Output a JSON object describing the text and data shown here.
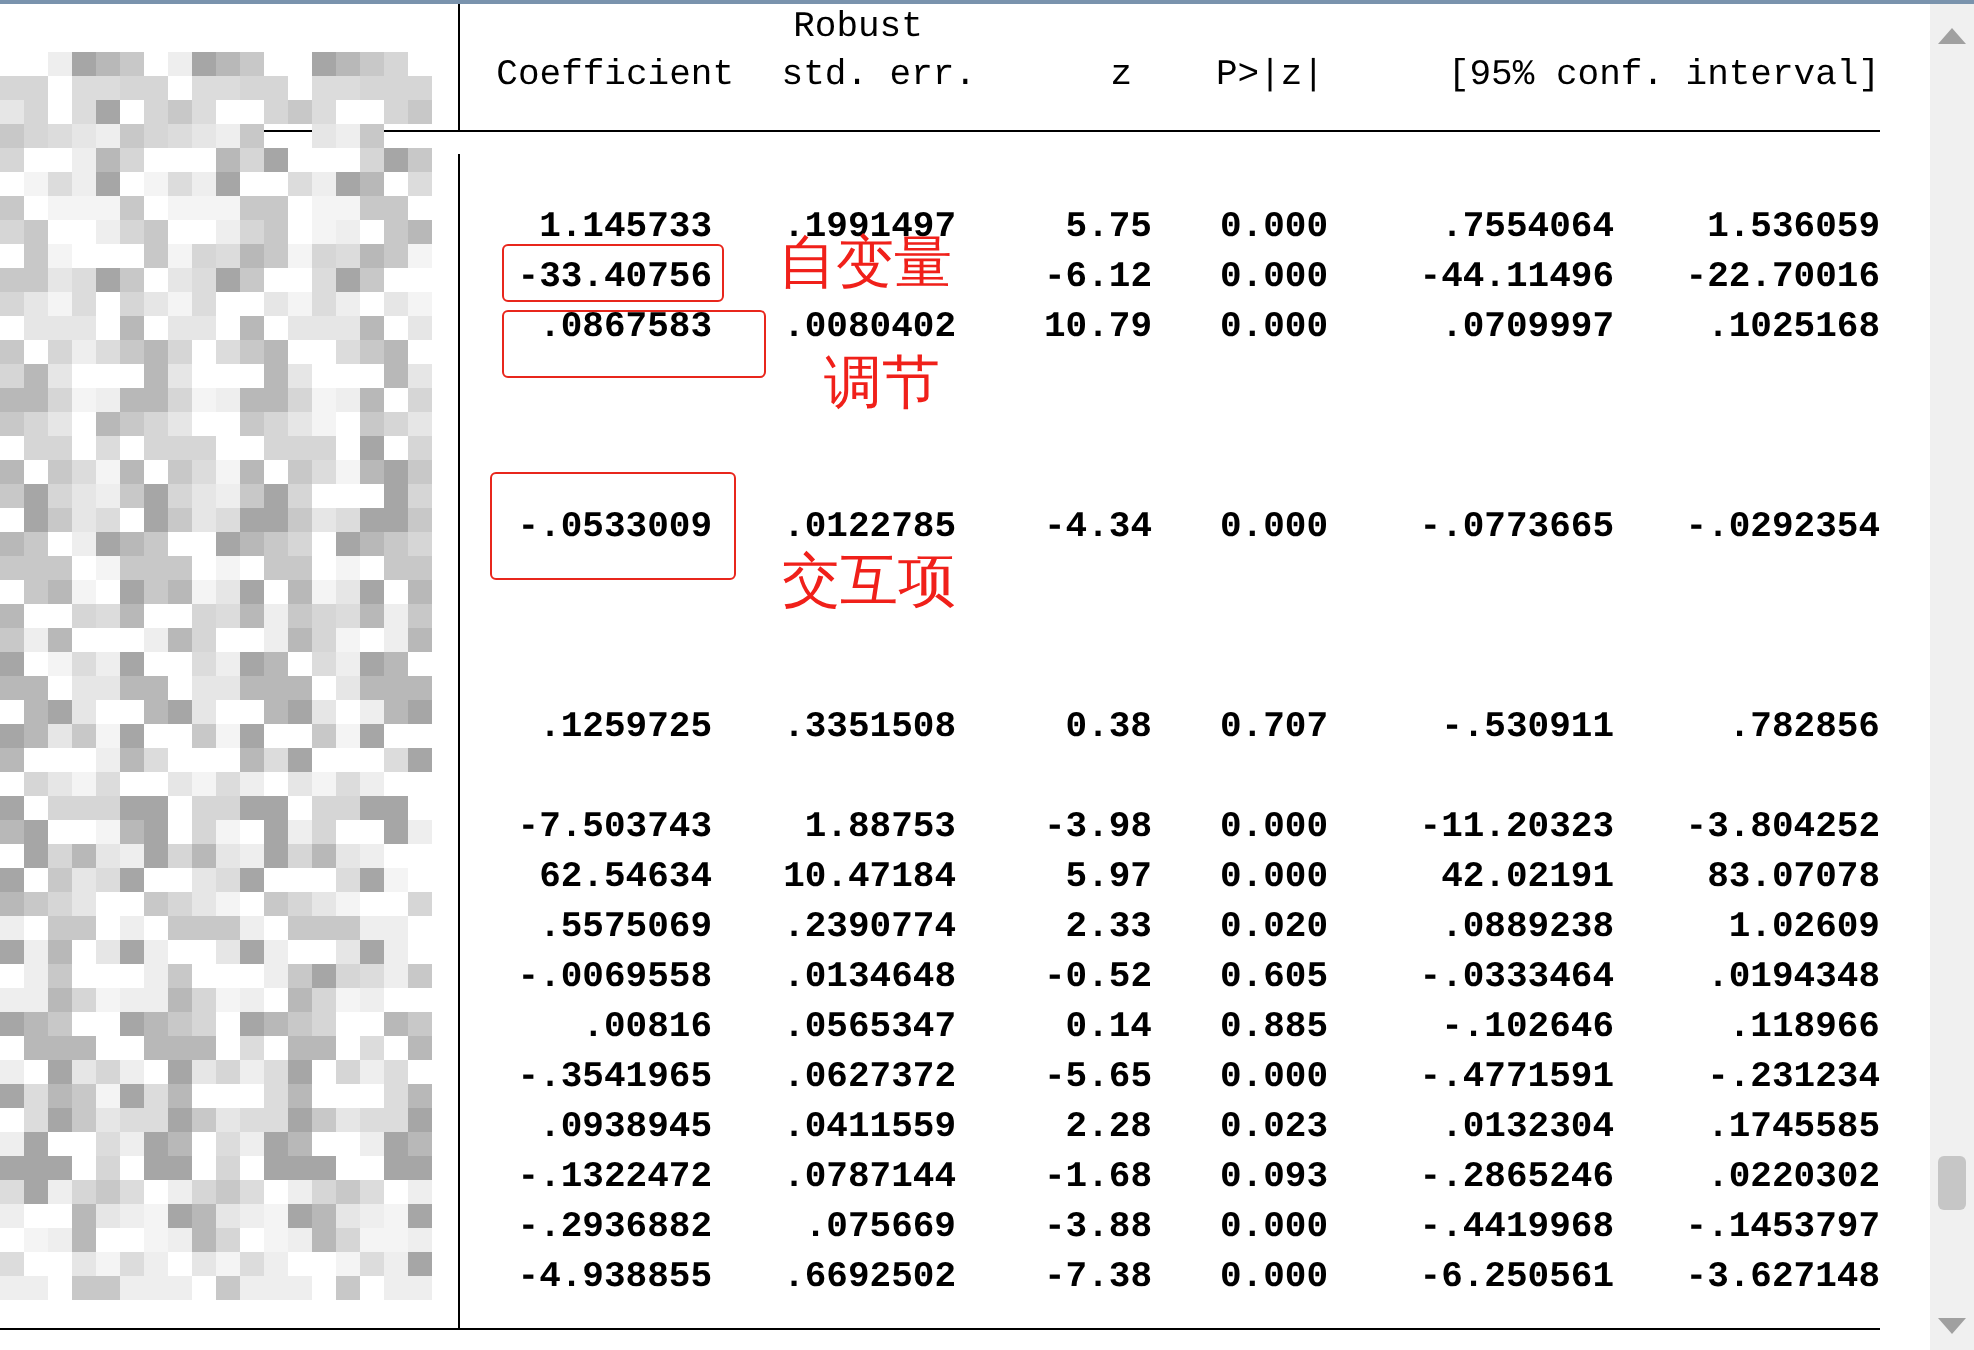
{
  "table": {
    "header_top": "Robust",
    "columns": [
      "Coefficient",
      "std. err.",
      "z",
      "P>|z|",
      "[95% conf. interval]"
    ],
    "rows": [
      {
        "kind": "spacer"
      },
      {
        "kind": "values",
        "boxed": false,
        "cells": [
          "1.145733",
          ".1991497",
          "5.75",
          "0.000",
          ".7554064",
          "1.536059"
        ]
      },
      {
        "kind": "values",
        "boxed": true,
        "cells": [
          "-33.40756",
          null,
          "-6.12",
          "0.000",
          "-44.11496",
          "-22.70016"
        ]
      },
      {
        "kind": "values",
        "boxed": true,
        "cells": [
          ".0867583",
          ".0080402",
          "10.79",
          "0.000",
          ".0709997",
          ".1025168"
        ]
      },
      {
        "kind": "spacer"
      },
      {
        "kind": "spacer"
      },
      {
        "kind": "spacer"
      },
      {
        "kind": "values",
        "boxed": true,
        "cells": [
          "-.0533009",
          ".0122785",
          "-4.34",
          "0.000",
          "-.0773665",
          "-.0292354"
        ]
      },
      {
        "kind": "spacer"
      },
      {
        "kind": "spacer"
      },
      {
        "kind": "spacer"
      },
      {
        "kind": "values",
        "boxed": false,
        "cells": [
          ".1259725",
          ".3351508",
          "0.38",
          "0.707",
          "-.530911",
          ".782856"
        ]
      },
      {
        "kind": "spacer"
      },
      {
        "kind": "values",
        "boxed": false,
        "cells": [
          "-7.503743",
          "1.88753",
          "-3.98",
          "0.000",
          "-11.20323",
          "-3.804252"
        ]
      },
      {
        "kind": "values",
        "boxed": false,
        "cells": [
          "62.54634",
          "10.47184",
          "5.97",
          "0.000",
          "42.02191",
          "83.07078"
        ]
      },
      {
        "kind": "values",
        "boxed": false,
        "cells": [
          ".5575069",
          ".2390774",
          "2.33",
          "0.020",
          ".0889238",
          "1.02609"
        ]
      },
      {
        "kind": "values",
        "boxed": false,
        "cells": [
          "-.0069558",
          ".0134648",
          "-0.52",
          "0.605",
          "-.0333464",
          ".0194348"
        ]
      },
      {
        "kind": "values",
        "boxed": false,
        "cells": [
          ".00816",
          ".0565347",
          "0.14",
          "0.885",
          "-.102646",
          ".118966"
        ]
      },
      {
        "kind": "values",
        "boxed": false,
        "cells": [
          "-.3541965",
          ".0627372",
          "-5.65",
          "0.000",
          "-.4771591",
          "-.231234"
        ]
      },
      {
        "kind": "values",
        "boxed": false,
        "cells": [
          ".0938945",
          ".0411559",
          "2.28",
          "0.023",
          ".0132304",
          ".1745585"
        ]
      },
      {
        "kind": "values",
        "boxed": false,
        "cells": [
          "-.1322472",
          ".0787144",
          "-1.68",
          "0.093",
          "-.2865246",
          ".0220302"
        ]
      },
      {
        "kind": "values",
        "boxed": false,
        "cells": [
          "-.2936882",
          ".075669",
          "-3.88",
          "0.000",
          "-.4419968",
          "-.1453797"
        ]
      },
      {
        "kind": "values",
        "boxed": false,
        "cells": [
          "-4.938855",
          ".6692502",
          "-7.38",
          "0.000",
          "-6.250561",
          "-3.627148"
        ]
      }
    ]
  },
  "annotations": [
    {
      "text": "自变量"
    },
    {
      "text": "调节"
    },
    {
      "text": "交互项"
    }
  ]
}
